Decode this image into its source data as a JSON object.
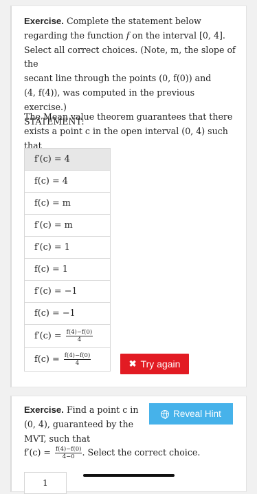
{
  "exercise1": {
    "label": "Exercise.",
    "line1": " Complete the statement below",
    "line2a": "regarding the function ",
    "line2f": "f",
    "line2b": " on the interval [0, 4].",
    "line3": "Select all correct choices. (Note, m, the slope of the",
    "line4": "secant line through the points (0, f(0)) and",
    "line5": "(4, f(4)), was computed in the previous exercise.)",
    "line6": "STATEMENT:",
    "stmt1": "The Mean value theorem guarantees that there",
    "stmt2": "exists a point c in the open interval (0, 4) such that"
  },
  "choices": [
    {
      "text": "f′(c) = 4",
      "selected": true
    },
    {
      "text": "f(c) = 4",
      "selected": false
    },
    {
      "text": "f(c) = m",
      "selected": false
    },
    {
      "text": "f′(c) = m",
      "selected": false
    },
    {
      "text": "f′(c) = 1",
      "selected": false
    },
    {
      "text": "f(c) = 1",
      "selected": false
    },
    {
      "text": "f′(c) = −1",
      "selected": false
    },
    {
      "text": "f(c) = −1",
      "selected": false
    }
  ],
  "frac_choices": [
    {
      "lhs": "f′(c) =",
      "num": "f(4)−f(0)",
      "den": "4"
    },
    {
      "lhs": "f(c) =",
      "num": "f(4)−f(0)",
      "den": "4"
    }
  ],
  "try_again": {
    "label": "Try again",
    "icon": "x-icon",
    "color": "#e21b23"
  },
  "exercise2": {
    "label": "Exercise.",
    "line1": " Find a point c in",
    "line2": "(0, 4), guaranteed by the",
    "line3": "MVT, such that",
    "line4_lhs": "f′(c) =",
    "line4_num": "f(4)−f(0)",
    "line4_den": "4−0",
    "line4_rest": ". Select the correct choice.",
    "hint_label": "Reveal Hint",
    "hint_icon": "globe-icon",
    "hint_color": "#46b2ea",
    "partial_answer": "1"
  }
}
